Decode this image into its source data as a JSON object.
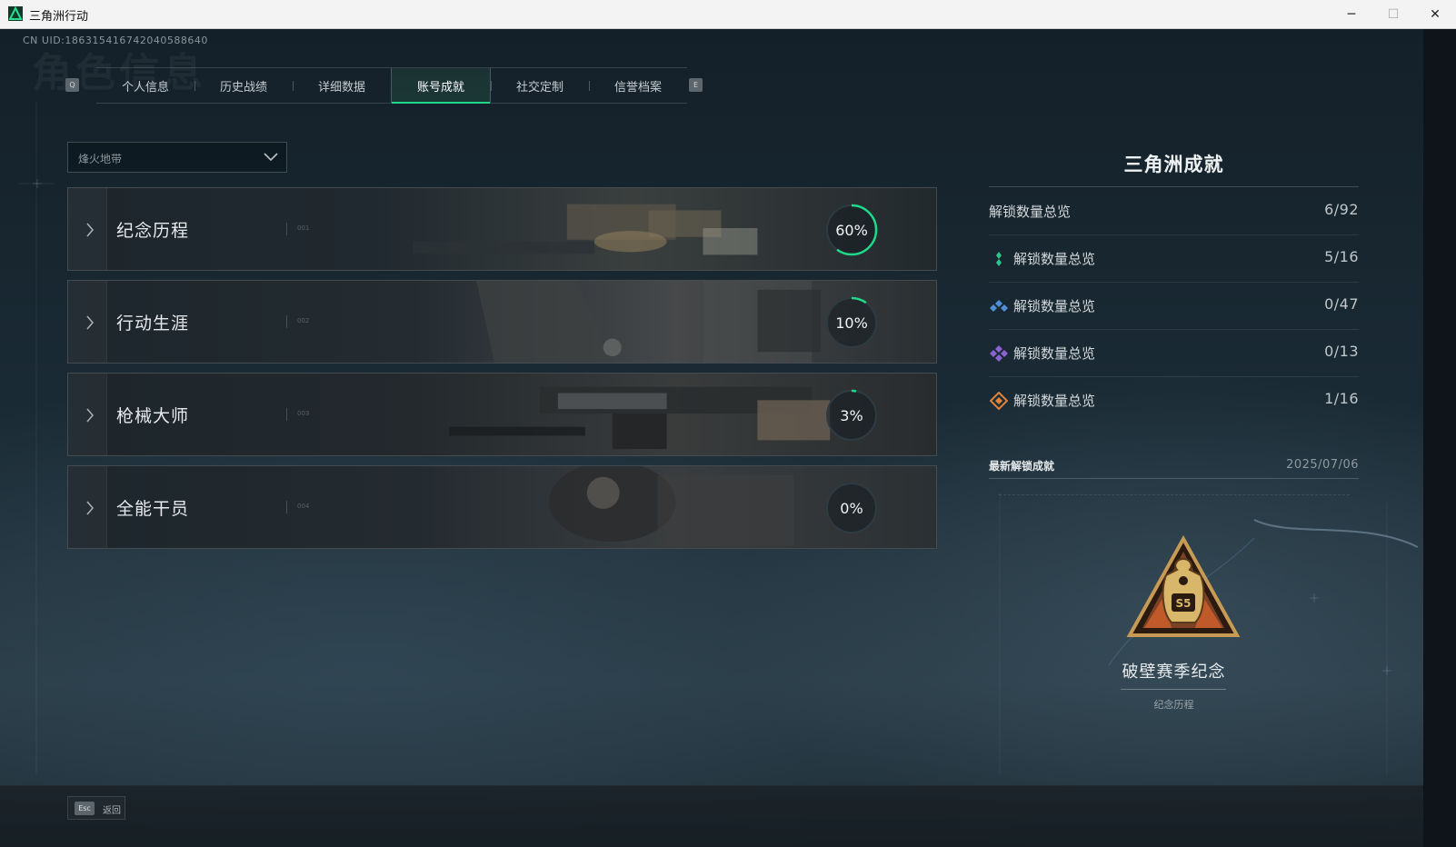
{
  "window": {
    "title": "三角洲行动",
    "minimize_glyph": "─",
    "maximize_glyph": "☐",
    "close_glyph": "✕"
  },
  "header": {
    "uid": "CN UID:186315416742040588640",
    "watermark": "角色信息"
  },
  "tabs": {
    "prev_key": "Q",
    "next_key": "E",
    "items": [
      {
        "label": "个人信息"
      },
      {
        "label": "历史战绩"
      },
      {
        "label": "详细数据"
      },
      {
        "label": "账号成就",
        "active": true
      },
      {
        "label": "社交定制"
      },
      {
        "label": "信誉档案"
      }
    ]
  },
  "mode_select": {
    "value": "烽火地带",
    "icon": "chevron-down-icon"
  },
  "categories": [
    {
      "name": "纪念历程",
      "index": "001",
      "percent_label": "60%",
      "progress": 0.6
    },
    {
      "name": "行动生涯",
      "index": "002",
      "percent_label": "10%",
      "progress": 0.1
    },
    {
      "name": "枪械大师",
      "index": "003",
      "percent_label": "3%",
      "progress": 0.03
    },
    {
      "name": "全能干员",
      "index": "004",
      "percent_label": "0%",
      "progress": 0.0
    }
  ],
  "summary": {
    "title": "三角洲成就",
    "overall": {
      "label": "解锁数量总览",
      "count": "6/92"
    },
    "tiers": [
      {
        "label": "解锁数量总览",
        "count": "5/16",
        "icon": "green-rank-icon",
        "color": "#2fc48a"
      },
      {
        "label": "解锁数量总览",
        "count": "0/47",
        "icon": "blue-rank-icon",
        "color": "#4f8fd6"
      },
      {
        "label": "解锁数量总览",
        "count": "0/13",
        "icon": "purple-rank-icon",
        "color": "#8a63d0"
      },
      {
        "label": "解锁数量总览",
        "count": "1/16",
        "icon": "orange-rank-icon",
        "color": "#e0833a"
      }
    ]
  },
  "latest": {
    "label": "最新解锁成就",
    "date": "2025/07/06",
    "badge_name": "破壁赛季纪念",
    "badge_category": "纪念历程",
    "badge_number": "S5"
  },
  "footer": {
    "esc_key": "Esc",
    "esc_label": "返回"
  },
  "colors": {
    "accent": "#1fd98a",
    "ring_track": "#2f3b42"
  }
}
